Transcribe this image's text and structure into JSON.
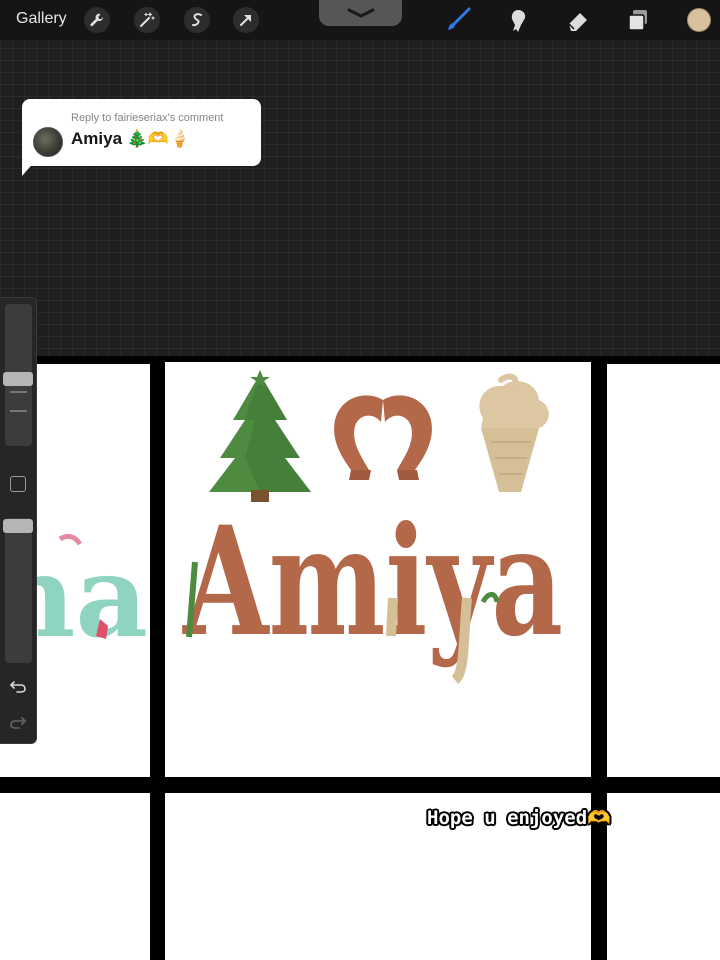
{
  "toolbar": {
    "gallery_label": "Gallery",
    "left_tools": [
      "wrench-icon",
      "magic-wand-icon",
      "selection-icon",
      "transform-arrow-icon"
    ],
    "right_tools": [
      "brush-icon",
      "smudge-icon",
      "eraser-icon",
      "layers-icon"
    ],
    "active_tool": "brush-icon",
    "accent_color": "#2f78e6",
    "current_color": "#d8c19c"
  },
  "comment": {
    "reply_to": "Reply to fairieseriax's comment",
    "author": "Amiya 🎄🫶🍦"
  },
  "artwork": {
    "name_text": "Amiya",
    "emojis": [
      "christmas-tree",
      "heart-hands",
      "ice-cream"
    ],
    "palette": {
      "green": "#4e8b40",
      "brown": "#b4684a",
      "cream": "#d5bf96",
      "teal": "#8fd4c0"
    },
    "left_partial_text": "na"
  },
  "caption": {
    "text": "Hope u enjoyed🫶"
  },
  "sidebar": {
    "buttons": [
      "undo-icon",
      "redo-icon"
    ]
  }
}
